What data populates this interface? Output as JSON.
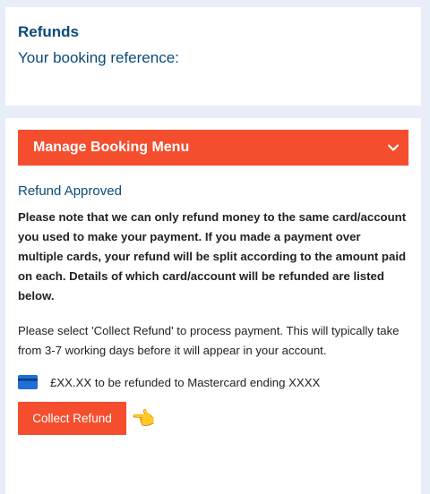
{
  "booking": {
    "title": "Refunds",
    "reference_label": "Your booking reference:"
  },
  "menu": {
    "label": "Manage Booking Menu",
    "chevron_icon": "chevron-down-icon"
  },
  "refund": {
    "status": "Refund Approved",
    "note": "Please note that we can only refund money to the same card/account you used to make your payment. If you made a payment over multiple cards, your refund will be split according to the amount paid on each. Details of which card/account will be refunded are listed below.",
    "instructions": "Please select 'Collect Refund' to process payment. This will typically take from 3-7 working days before it will appear in your account.",
    "line_item": "£XX.XX to be refunded to Mastercard ending XXXX",
    "card_icon": "credit-card-icon",
    "collect_label": "Collect Refund",
    "pointer_icon": "pointing-left-hand-icon",
    "pointer_glyph": "👈"
  },
  "colors": {
    "accent": "#f44e2e",
    "heading": "#0b4a7a",
    "background": "#e8eef7"
  }
}
